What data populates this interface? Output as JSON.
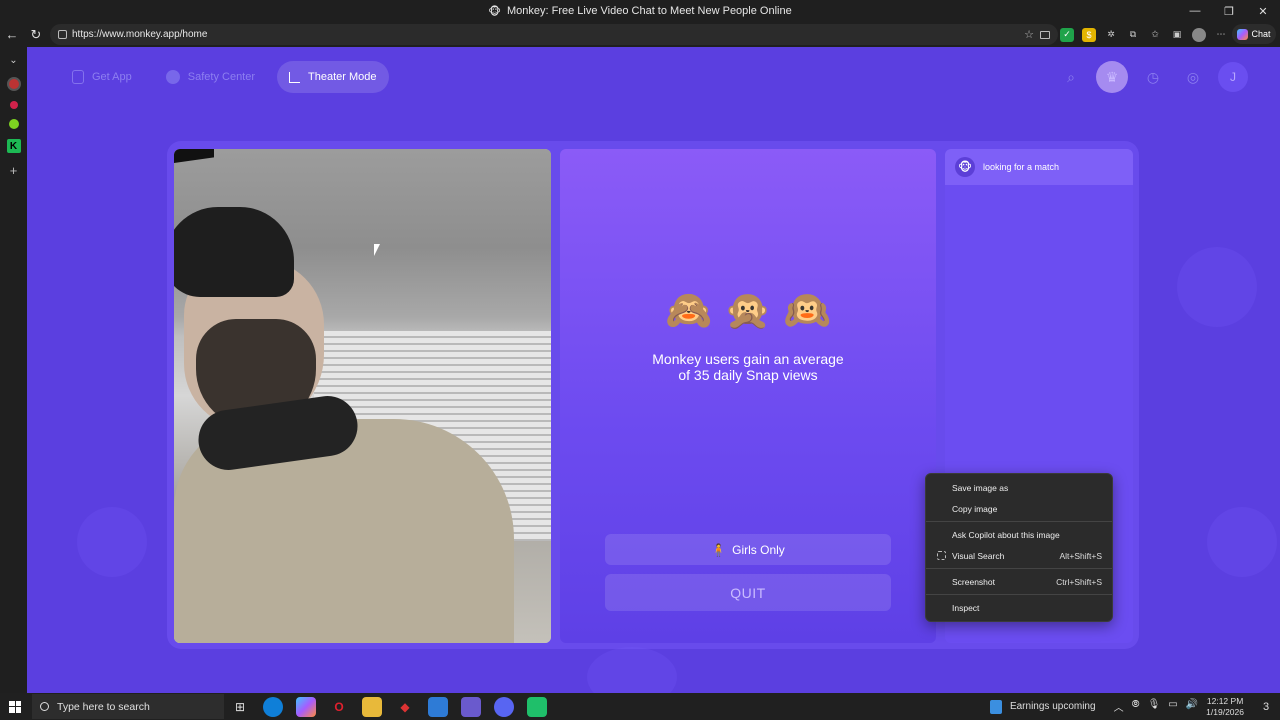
{
  "window": {
    "title": "Monkey: Free Live Video Chat to Meet New People Online",
    "favicon": "🐵"
  },
  "browser": {
    "url": "https://www.monkey.app/home",
    "chat_label": "Chat"
  },
  "nav": {
    "get_app": "Get App",
    "safety_center": "Safety Center",
    "theater_mode": "Theater Mode",
    "avatar_initial": "J"
  },
  "main": {
    "monkey_emojis": [
      "🙈",
      "🙊",
      "🙉"
    ],
    "tagline": "Monkey users gain an average of 35 daily Snap views",
    "girls_only_label": "Girls Only",
    "girls_only_icon": "🧍",
    "quit_label": "QUIT"
  },
  "chat": {
    "status": "looking for a match",
    "status_icon": "🐵"
  },
  "context_menu": {
    "items": [
      {
        "label": "Save image as",
        "shortcut": ""
      },
      {
        "label": "Copy image",
        "shortcut": ""
      },
      {
        "label": "Ask Copilot about this image",
        "shortcut": ""
      },
      {
        "label": "Visual Search",
        "shortcut": "Alt+Shift+S"
      },
      {
        "label": "Screenshot",
        "shortcut": "Ctrl+Shift+S"
      },
      {
        "label": "Inspect",
        "shortcut": ""
      }
    ]
  },
  "taskbar": {
    "search_placeholder": "Type here to search",
    "news_label": "Earnings upcoming",
    "time": "12:12 PM",
    "date": "1/19/2026",
    "notification_count": "3"
  },
  "colors": {
    "brand_purple": "#5b3fe0",
    "panel_purple": "#8b5bf7"
  }
}
